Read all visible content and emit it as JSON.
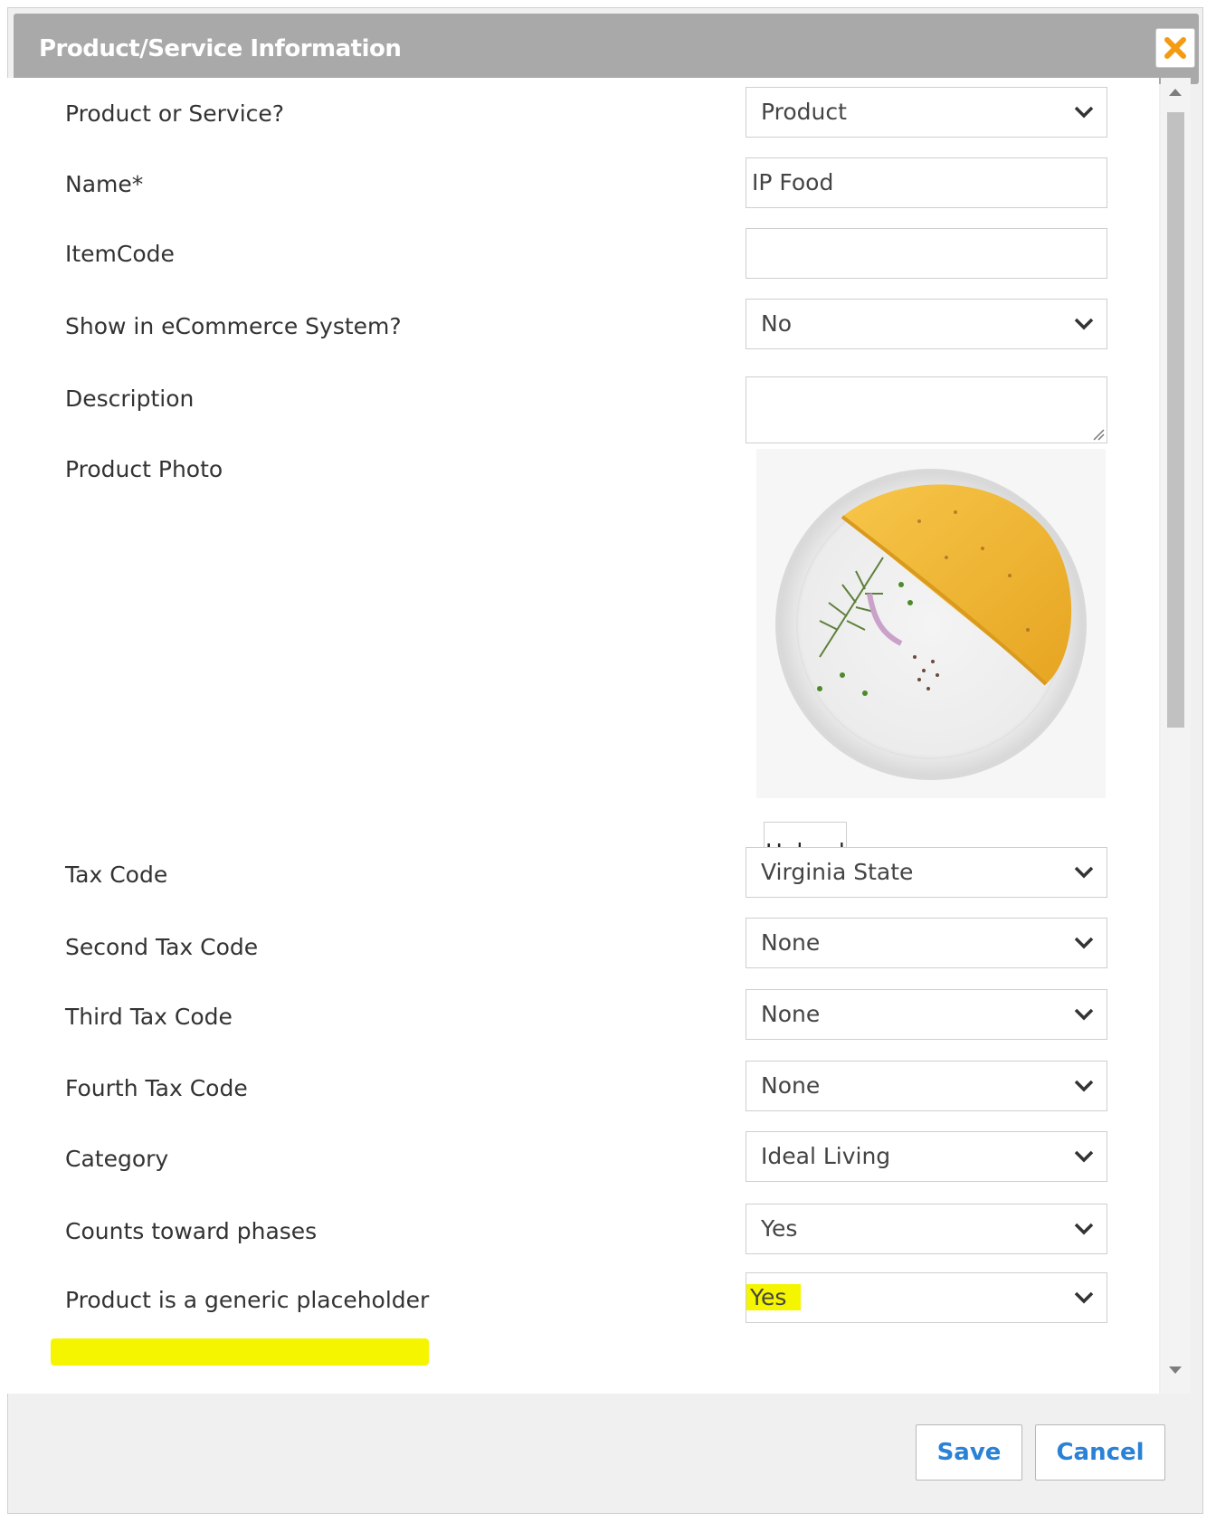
{
  "dialog": {
    "title": "Product/Service Information",
    "accent": "#f39c12"
  },
  "fields": {
    "product_or_service": {
      "label": "Product or Service?",
      "value": "Product"
    },
    "name": {
      "label": "Name*",
      "value": "IP Food"
    },
    "item_code": {
      "label": "ItemCode",
      "value": ""
    },
    "show_ecommerce": {
      "label": "Show in eCommerce System?",
      "value": "No"
    },
    "description": {
      "label": "Description",
      "value": ""
    },
    "product_photo": {
      "label": "Product Photo",
      "upload_label": "Upload"
    },
    "tax_code": {
      "label": "Tax Code",
      "value": "Virginia State"
    },
    "second_tax_code": {
      "label": "Second Tax Code",
      "value": "None"
    },
    "third_tax_code": {
      "label": "Third Tax Code",
      "value": "None"
    },
    "fourth_tax_code": {
      "label": "Fourth Tax Code",
      "value": "None"
    },
    "category": {
      "label": "Category",
      "value": "Ideal Living"
    },
    "counts_toward_phases": {
      "label": "Counts toward phases",
      "value": "Yes"
    },
    "generic_placeholder": {
      "label": "Product is a generic placeholder",
      "value": "Yes",
      "highlight": "#f5f500"
    }
  },
  "footer": {
    "save_label": "Save",
    "cancel_label": "Cancel",
    "button_text_color": "#2a82d6"
  }
}
